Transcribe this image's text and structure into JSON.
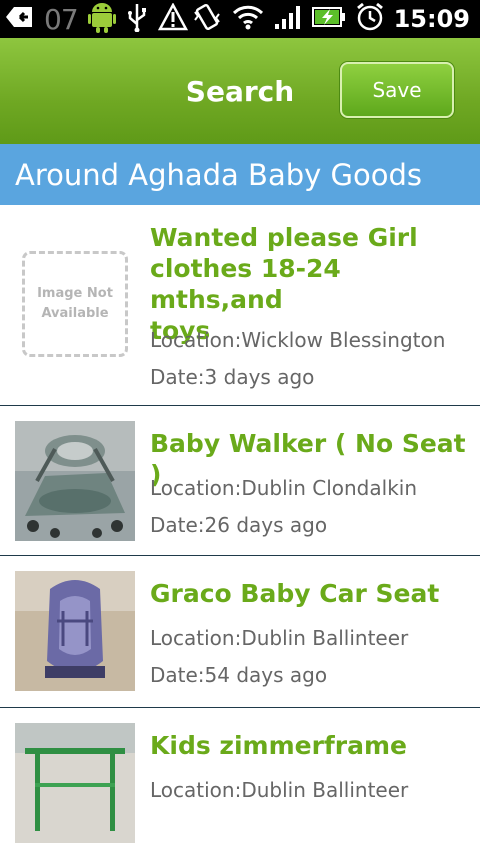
{
  "statusbar": {
    "left_number": "07",
    "clock": "15:09"
  },
  "header": {
    "title": "Search",
    "save_label": "Save"
  },
  "banner": {
    "text": "Around Aghada  Baby Goods"
  },
  "items": [
    {
      "title_lines": [
        "Wanted please Girl",
        "clothes 18-24 mths,and",
        "toys"
      ],
      "location": "Location:Wicklow Blessington",
      "date": "Date:3 days ago",
      "image": "Image Not Available"
    },
    {
      "title": "Baby Walker ( No Seat )",
      "location": "Location:Dublin Clondalkin",
      "date": "Date:26 days ago"
    },
    {
      "title": "Graco Baby Car Seat",
      "location": "Location:Dublin Ballinteer",
      "date": "Date:54 days ago"
    },
    {
      "title": "Kids zimmerframe",
      "location": "Location:Dublin Ballinteer"
    }
  ]
}
